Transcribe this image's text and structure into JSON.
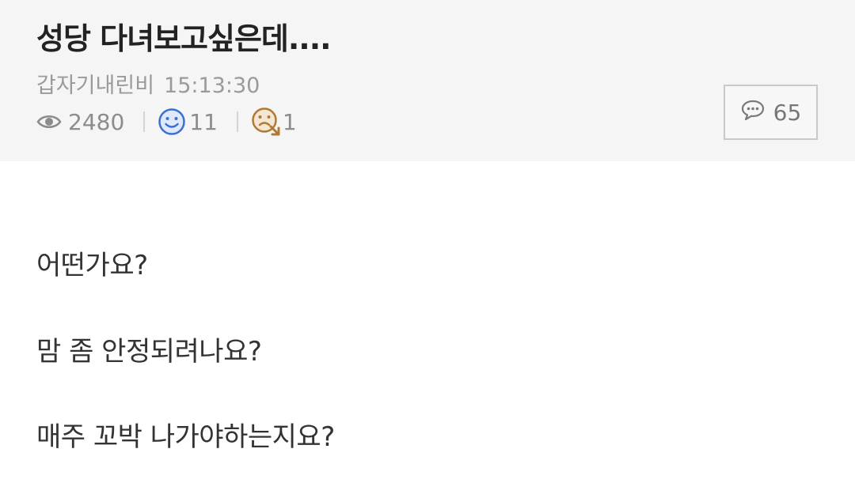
{
  "post": {
    "title": "성당 다녀보고싶은데....",
    "author": "갑자기내린비",
    "time": "15:13:30",
    "views": "2480",
    "likes": "11",
    "dislikes": "1",
    "comments": "65",
    "paragraphs": [
      "어떤가요?",
      "맘 좀 안정되려나요?",
      "매주 꼬박 나가야하는지요?"
    ]
  },
  "icons": {
    "views": "eye-icon",
    "likes": "smile-face-icon",
    "dislikes": "frown-face-icon",
    "comments": "speech-bubble-icon"
  },
  "colors": {
    "header_bg": "#f5f5f5",
    "like_icon": "#3b6fd3",
    "dislike_icon": "#b07a33"
  }
}
